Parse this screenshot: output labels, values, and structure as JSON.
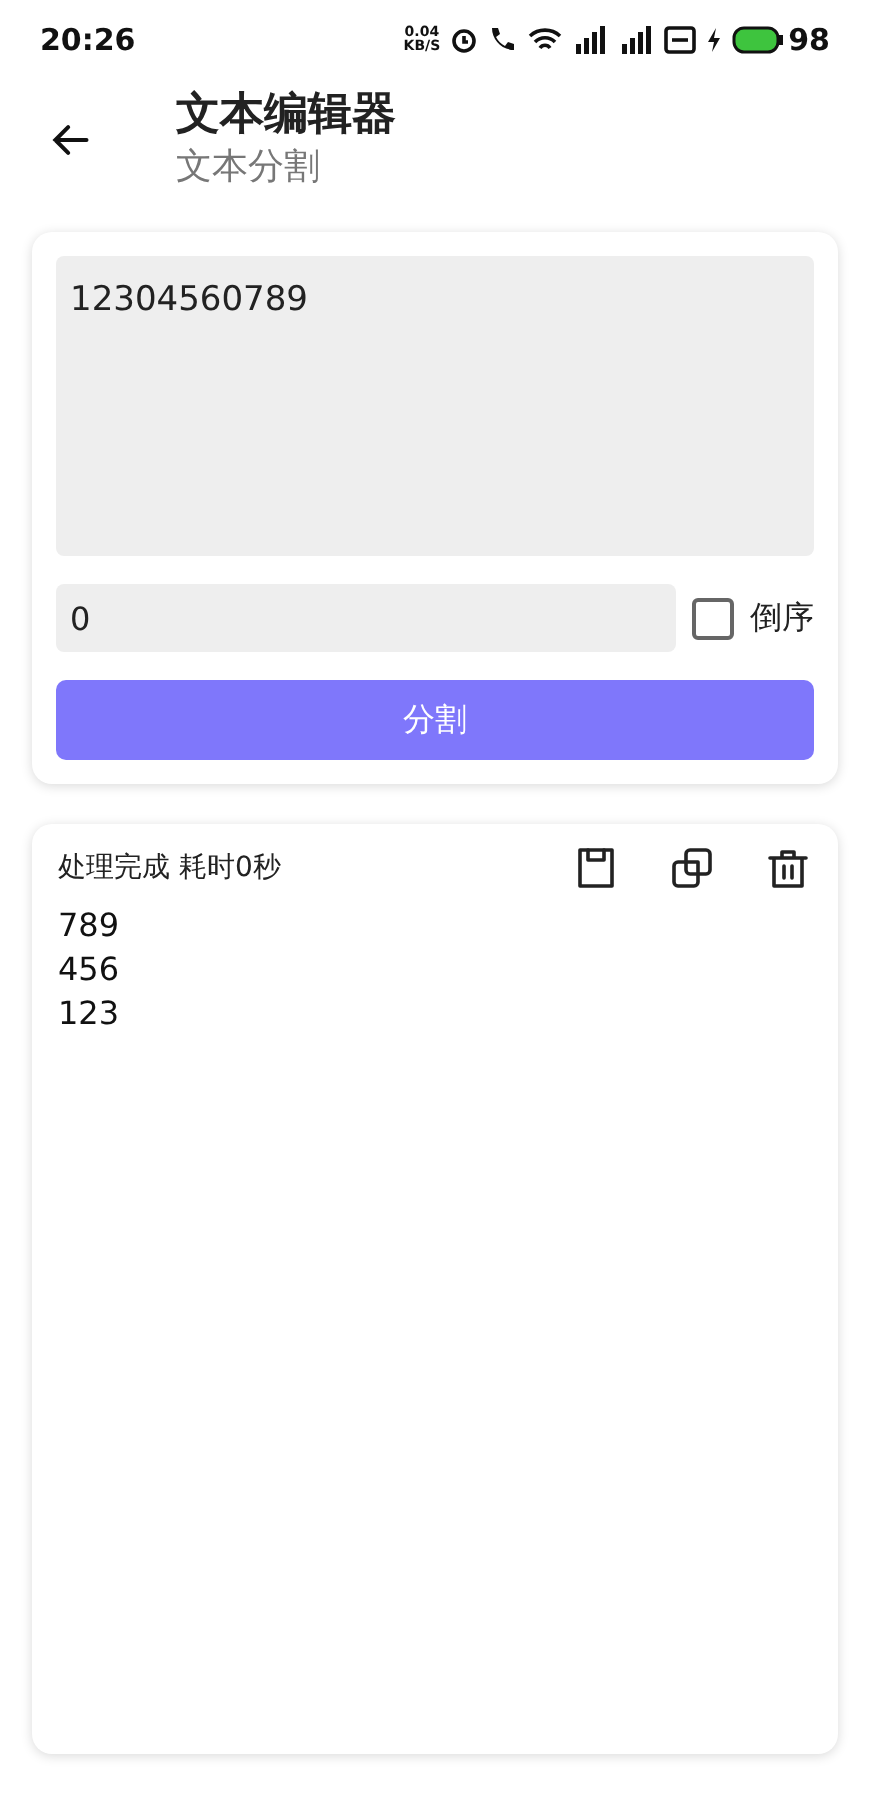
{
  "status_bar": {
    "time": "20:26",
    "speed_value": "0.04",
    "speed_unit": "KB/S",
    "battery": "98"
  },
  "header": {
    "title": "文本编辑器",
    "subtitle": "文本分割"
  },
  "input_card": {
    "text": "12304560789",
    "separator": "0",
    "reverse": {
      "label": "倒序",
      "checked": false
    },
    "button": "分割"
  },
  "result_card": {
    "status": "处理完成 耗时0秒",
    "lines": [
      "789",
      "456",
      "123"
    ]
  }
}
